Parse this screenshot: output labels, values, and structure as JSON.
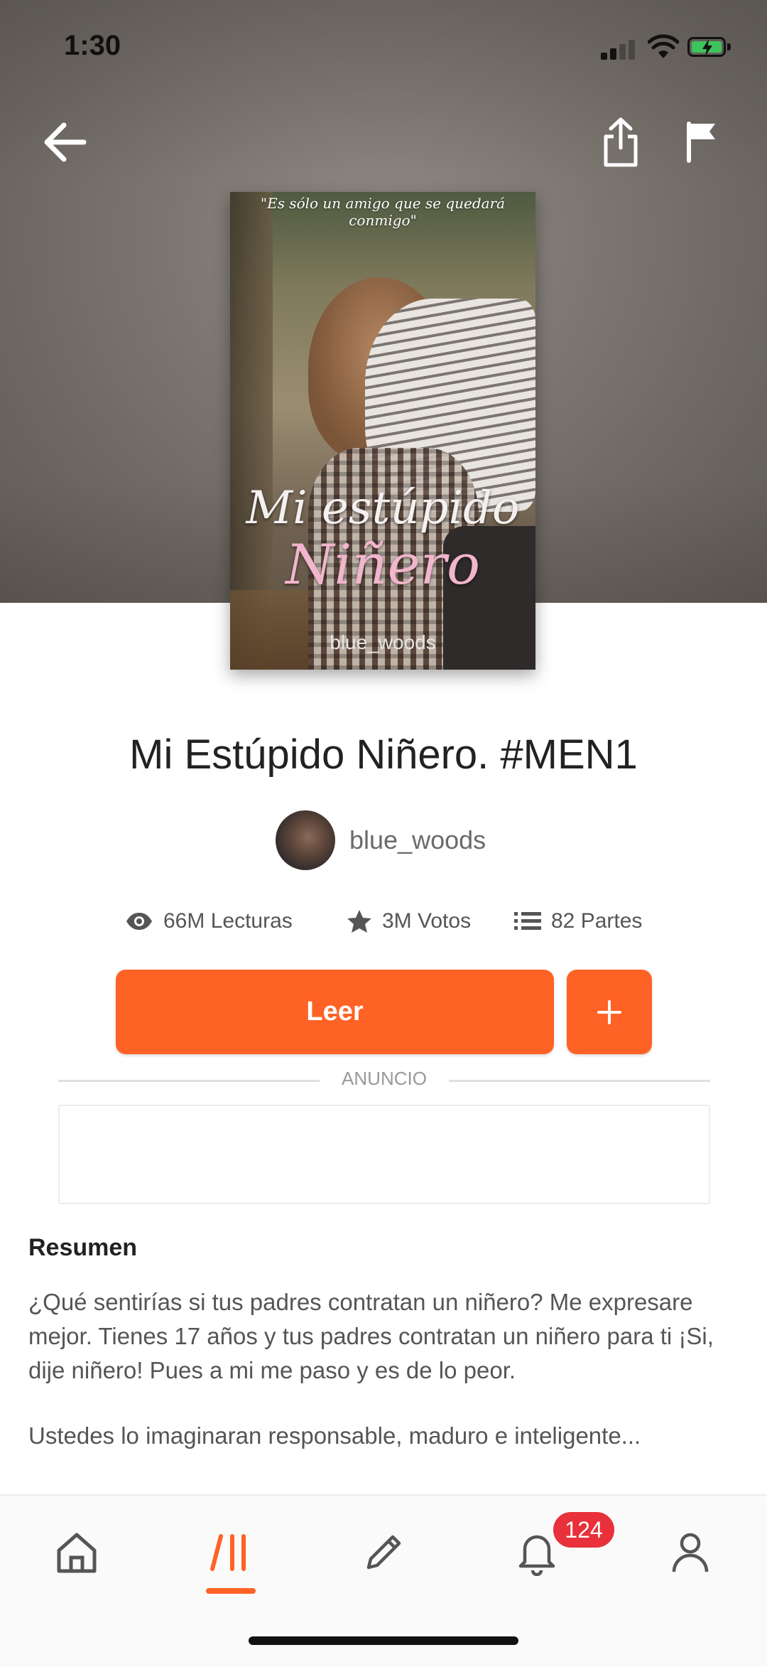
{
  "status_bar": {
    "time": "1:30"
  },
  "book": {
    "cover_tagline": "\"Es sólo un amigo que se quedará conmigo\"",
    "cover_title_line1": "Mi estúpido",
    "cover_title_line2": "Niñero",
    "cover_author": "blue_woods",
    "title": "Mi Estúpido Niñero. #MEN1",
    "author": "blue_woods",
    "stats": {
      "reads": "66M Lecturas",
      "votes": "3M Votos",
      "parts": "82 Partes"
    }
  },
  "actions": {
    "read_label": "Leer",
    "add_label": "+"
  },
  "ad": {
    "label": "ANUNCIO"
  },
  "summary": {
    "heading": "Resumen",
    "paragraph1": "¿Qué sentirías si tus padres contratan un niñero? Me expresare mejor. Tienes 17 años y tus padres contratan un niñero para ti ¡Si, dije niñero! Pues a mi me paso y es de lo peor.",
    "paragraph2": "Ustedes lo imaginaran responsable, maduro e inteligente..."
  },
  "bottom_nav": {
    "items": [
      "home-icon",
      "browse-icon",
      "write-icon",
      "notifications-icon",
      "profile-icon"
    ],
    "notifications_badge": "124"
  },
  "colors": {
    "accent": "#ff6225",
    "badge": "#e8313a"
  }
}
